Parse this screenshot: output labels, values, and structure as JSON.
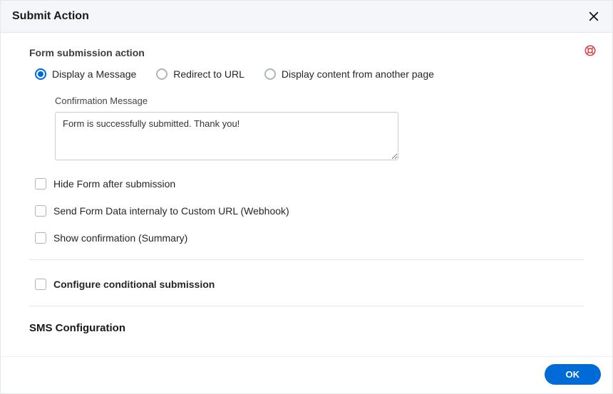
{
  "header": {
    "title": "Submit Action"
  },
  "form": {
    "sectionLabel": "Form submission action",
    "radios": {
      "display": "Display a Message",
      "redirect": "Redirect to URL",
      "another": "Display content from another page"
    },
    "confirmation": {
      "label": "Confirmation Message",
      "value": "Form is successfully submitted. Thank you!"
    },
    "checks": {
      "hide": "Hide Form after submission",
      "webhook": "Send Form Data internaly to Custom URL (Webhook)",
      "summary": "Show confirmation (Summary)",
      "conditional": "Configure conditional submission"
    },
    "cutoffSection": "SMS Configuration"
  },
  "footer": {
    "ok": "OK"
  }
}
